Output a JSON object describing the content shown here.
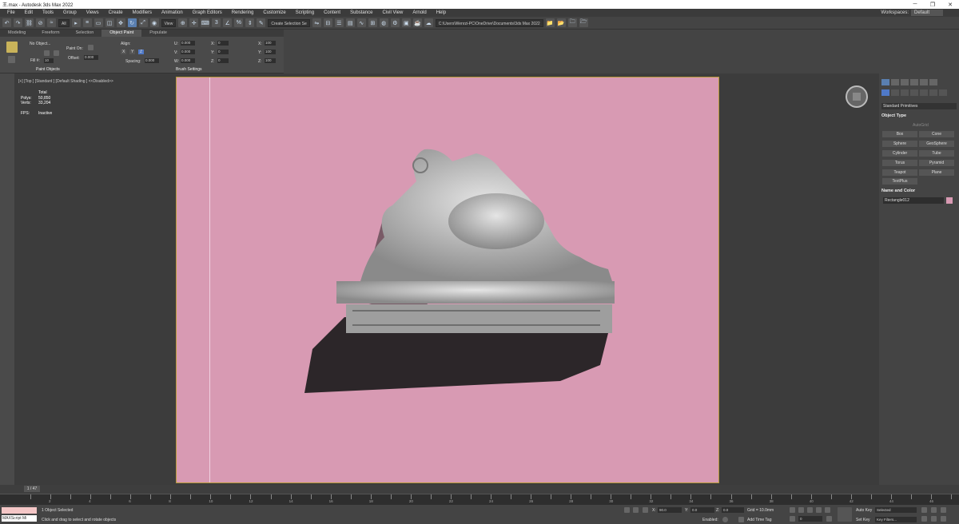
{
  "window": {
    "title": "王.max - Autodesk 3ds Max 2022",
    "btn_min": "─",
    "btn_max": "❐",
    "btn_close": "✕"
  },
  "menu": [
    "File",
    "Edit",
    "Tools",
    "Group",
    "Views",
    "Create",
    "Modifiers",
    "Animation",
    "Graph Editors",
    "Rendering",
    "Customize",
    "Scripting",
    "Content",
    "Substance",
    "Civil View",
    "Arnold",
    "Help"
  ],
  "workspaces": {
    "label": "Workspaces:",
    "value": "Default"
  },
  "toolbar": {
    "filter": "All",
    "view": "View",
    "selection_set": "Create Selection Se",
    "path": "C:\\Users\\Wenrzi-PC\\OneDrive\\Documents\\3ds Max 2022"
  },
  "ribbon": {
    "tabs": [
      "Modeling",
      "Freeform",
      "Selection",
      "Object Paint",
      "Populate"
    ],
    "active_tab": "Object Paint",
    "no_object": "No Object...",
    "paint_on": "Paint On:",
    "fill_label": "Fill #:",
    "fill_value": "10",
    "offset_label": "Offset:",
    "offset_value": "0.000",
    "align": "Align:",
    "x": "X",
    "y": "Y",
    "z": "Z",
    "spacing_label": "Spacing:",
    "spacing_value": "0.000",
    "u_label": "U:",
    "v_label": "V:",
    "w_label": "W:",
    "u": "0.000",
    "v": "0.000",
    "w": "0.000",
    "rx_label": "X:",
    "ry_label": "Y:",
    "rz_label": "Z:",
    "rx": "0",
    "ry": "0",
    "rz": "0",
    "sx_label": "X:",
    "sy_label": "Y:",
    "sz_label": "Z:",
    "sx": "100",
    "sy": "100",
    "sz": "100",
    "group_paint": "Paint Objects",
    "group_brush": "Brush Settings"
  },
  "viewport": {
    "label": "[+] [Top ] [Standard ] [Default Shading ]  <<Disabled>>",
    "stats_total": "Total",
    "polys_label": "Polys:",
    "polys": "50,850",
    "verts_label": "Verts:",
    "verts": "33,204",
    "fps_label": "FPS:",
    "fps": "Inactive"
  },
  "command_panel": {
    "category": "Standard Primitives",
    "object_type": "Object Type",
    "autogrid": "AutoGrid",
    "objects": [
      "Box",
      "Cone",
      "Sphere",
      "GeoSphere",
      "Cylinder",
      "Tube",
      "Torus",
      "Pyramid",
      "Teapot",
      "Plane",
      "TextPlus"
    ],
    "name_and_color": "Name and Color",
    "name": "Rectangle012",
    "color": "#d89ab3"
  },
  "timeline": {
    "frame": "1 / 47",
    "ticks": [
      "1",
      "2",
      "3",
      "4",
      "5",
      "6",
      "7",
      "8",
      "9",
      "10",
      "11",
      "12",
      "13",
      "14",
      "15",
      "16",
      "17",
      "18",
      "19",
      "20",
      "21",
      "22",
      "23",
      "24",
      "25",
      "26",
      "27",
      "28",
      "29",
      "30",
      "31",
      "32",
      "33",
      "34",
      "35",
      "36",
      "37",
      "38",
      "39",
      "40",
      "41",
      "42",
      "43",
      "44",
      "45",
      "46",
      "47"
    ]
  },
  "status": {
    "script_label": "MAXScript Mi",
    "selected": "1 Object Selected",
    "prompt": "Click and drag to select and rotate objects",
    "x_label": "X:",
    "x": "90.0",
    "y_label": "Y:",
    "y": "0.0",
    "z_label": "Z:",
    "z": "0.0",
    "grid": "Grid = 10.0mm",
    "enabled": "Enabled:",
    "add_time_tag": "Add Time Tag",
    "autokey": "Auto Key",
    "selected_mode": "Selected",
    "setkey": "Set Key",
    "key_filters": "Key Filters...",
    "frame_field": "0"
  }
}
